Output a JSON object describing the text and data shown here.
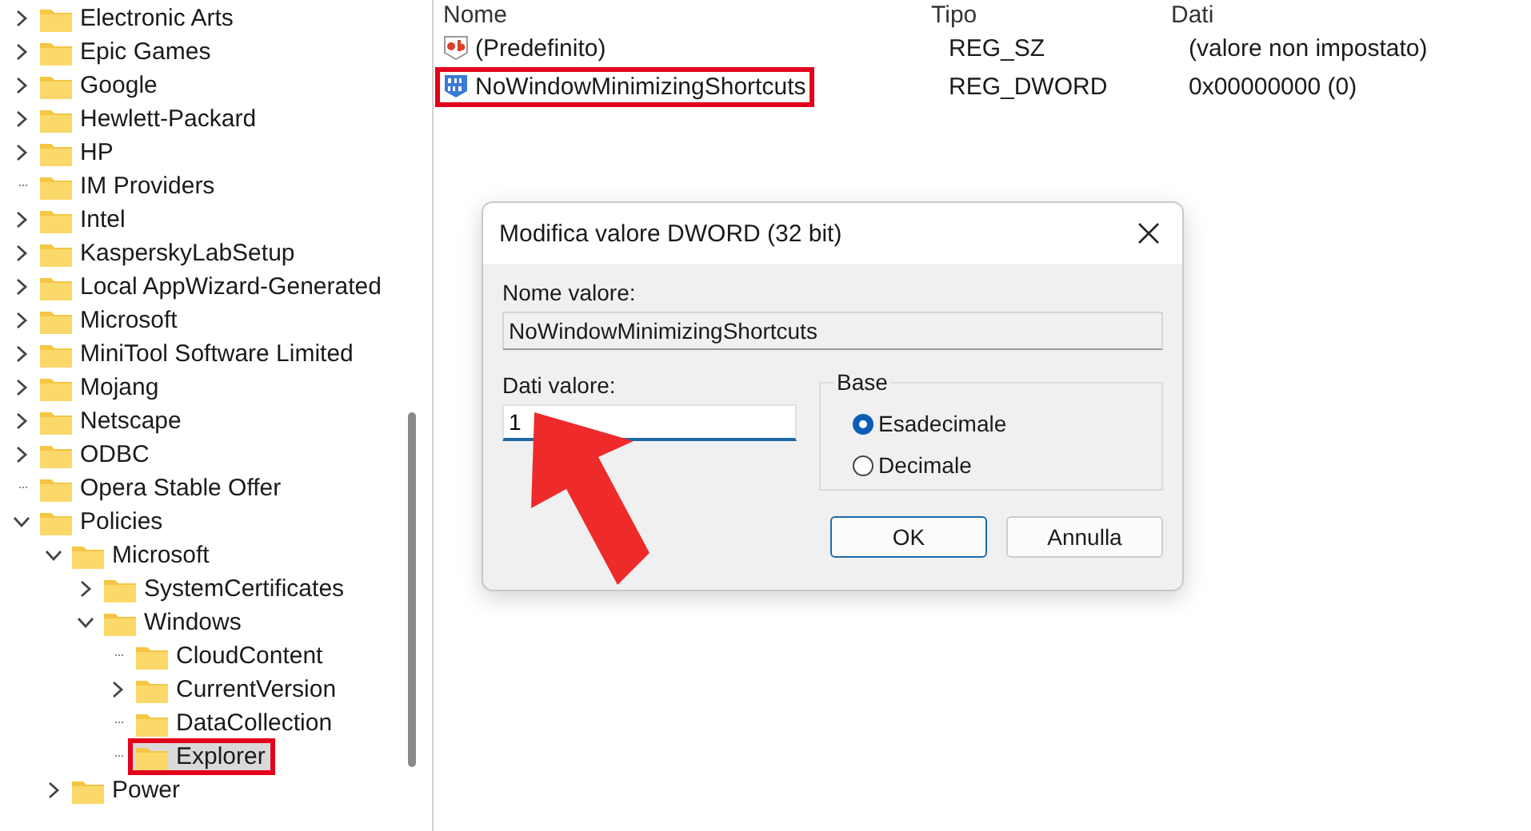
{
  "tree": [
    {
      "label": "Electronic Arts",
      "kind": "branch",
      "expanded": false,
      "selected": false,
      "highlighted": false
    },
    {
      "label": "Epic Games",
      "kind": "branch",
      "expanded": false,
      "selected": false,
      "highlighted": false
    },
    {
      "label": "Google",
      "kind": "branch",
      "expanded": false,
      "selected": false,
      "highlighted": false
    },
    {
      "label": "Hewlett-Packard",
      "kind": "branch",
      "expanded": false,
      "selected": false,
      "highlighted": false
    },
    {
      "label": "HP",
      "kind": "branch",
      "expanded": false,
      "selected": false,
      "highlighted": false
    },
    {
      "label": "IM Providers",
      "kind": "leaf",
      "selected": false,
      "highlighted": false
    },
    {
      "label": "Intel",
      "kind": "branch",
      "expanded": false,
      "selected": false,
      "highlighted": false
    },
    {
      "label": "KasperskyLabSetup",
      "kind": "branch",
      "expanded": false,
      "selected": false,
      "highlighted": false
    },
    {
      "label": "Local AppWizard-Generated",
      "kind": "branch",
      "expanded": false,
      "selected": false,
      "highlighted": false
    },
    {
      "label": "Microsoft",
      "kind": "branch",
      "expanded": false,
      "selected": false,
      "highlighted": false
    },
    {
      "label": "MiniTool Software Limited",
      "kind": "branch",
      "expanded": false,
      "selected": false,
      "highlighted": false
    },
    {
      "label": "Mojang",
      "kind": "branch",
      "expanded": false,
      "selected": false,
      "highlighted": false
    },
    {
      "label": "Netscape",
      "kind": "branch",
      "expanded": false,
      "selected": false,
      "highlighted": false
    },
    {
      "label": "ODBC",
      "kind": "branch",
      "expanded": false,
      "selected": false,
      "highlighted": false
    },
    {
      "label": "Opera Stable Offer",
      "kind": "leaf",
      "selected": false,
      "highlighted": false
    },
    {
      "label": "Policies",
      "kind": "branch",
      "expanded": true,
      "selected": false,
      "highlighted": false,
      "children": [
        {
          "label": "Microsoft",
          "kind": "branch",
          "expanded": true,
          "selected": false,
          "highlighted": false,
          "children": [
            {
              "label": "SystemCertificates",
              "kind": "branch",
              "expanded": false,
              "selected": false,
              "highlighted": false
            },
            {
              "label": "Windows",
              "kind": "branch",
              "expanded": true,
              "selected": false,
              "highlighted": false,
              "children": [
                {
                  "label": "CloudContent",
                  "kind": "leaf",
                  "selected": false,
                  "highlighted": false
                },
                {
                  "label": "CurrentVersion",
                  "kind": "branch",
                  "expanded": false,
                  "selected": false,
                  "highlighted": false
                },
                {
                  "label": "DataCollection",
                  "kind": "leaf",
                  "selected": false,
                  "highlighted": false
                },
                {
                  "label": "Explorer",
                  "kind": "leaf",
                  "selected": true,
                  "highlighted": true
                }
              ]
            }
          ]
        },
        {
          "label": "Power",
          "kind": "branch",
          "expanded": false,
          "selected": false,
          "highlighted": false
        }
      ]
    }
  ],
  "values": {
    "columns": [
      "Nome",
      "Tipo",
      "Dati"
    ],
    "rows": [
      {
        "kind": "string",
        "name": "(Predefinito)",
        "type": "REG_SZ",
        "data": "(valore non impostato)",
        "highlighted": false
      },
      {
        "kind": "dword",
        "name": "NoWindowMinimizingShortcuts",
        "type": "REG_DWORD",
        "data": "0x00000000 (0)",
        "highlighted": true
      }
    ]
  },
  "dialog": {
    "title": "Modifica valore DWORD (32 bit)",
    "name_label": "Nome valore:",
    "name_value": "NoWindowMinimizingShortcuts",
    "data_label": "Dati valore:",
    "data_value": "1",
    "base_label": "Base",
    "bases": [
      {
        "label": "Esadecimale",
        "selected": true
      },
      {
        "label": "Decimale",
        "selected": false
      }
    ],
    "buttons": [
      {
        "label": "OK",
        "kind": "default"
      },
      {
        "label": "Annulla",
        "kind": "normal"
      }
    ]
  }
}
